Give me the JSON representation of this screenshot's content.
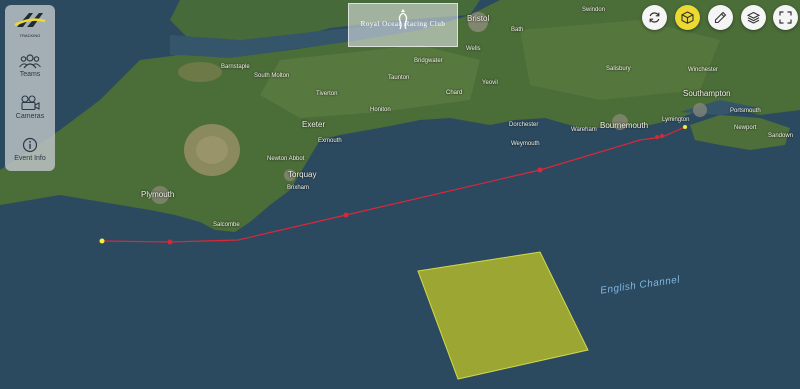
{
  "app": {
    "logo_text": "TRACKING"
  },
  "sidebar": {
    "items": [
      {
        "label": "Teams",
        "icon": "teams-icon"
      },
      {
        "label": "Cameras",
        "icon": "camera-icon"
      },
      {
        "label": "Event Info",
        "icon": "info-icon"
      }
    ]
  },
  "club": {
    "name": "Royal Ocean Racing Club"
  },
  "toolbar": {
    "buttons": [
      {
        "icon": "refresh-icon",
        "active": false
      },
      {
        "icon": "3d-cube-icon",
        "active": true
      },
      {
        "icon": "ruler-icon",
        "active": false
      },
      {
        "icon": "layers-icon",
        "active": false
      },
      {
        "icon": "fullscreen-icon",
        "active": false
      }
    ]
  },
  "map": {
    "sea_label": "English Channel",
    "places": {
      "bristol": "Bristol",
      "swindon": "Swindon",
      "bath": "Bath",
      "wells": "Wells",
      "barnstaple": "Barnstaple",
      "south_molton": "South Molton",
      "tiverton": "Tiverton",
      "honiton": "Honiton",
      "exeter": "Exeter",
      "exmouth": "Exmouth",
      "newton_abbot": "Newton Abbot",
      "torquay": "Torquay",
      "brixham": "Brixham",
      "plymouth": "Plymouth",
      "salcombe": "Salcombe",
      "dorchester": "Dorchester",
      "weymouth": "Weymouth",
      "bournemouth": "Bournemouth",
      "wareham": "Wareham",
      "southampton": "Southampton",
      "portsmouth": "Portsmouth",
      "newport": "Newport",
      "winchester": "Winchester",
      "salisbury": "Salisbury",
      "taunton": "Taunton",
      "yeovil": "Yeovil",
      "bridgwater": "Bridgwater",
      "lymington": "Lymington",
      "sandown": "Sandown",
      "chard": "Chard"
    }
  },
  "colors": {
    "sea": "#2d4a5e",
    "land": "#4a6a36",
    "track": "#d8283a",
    "zone": "#b5bc2a",
    "accent": "#ecd931"
  }
}
